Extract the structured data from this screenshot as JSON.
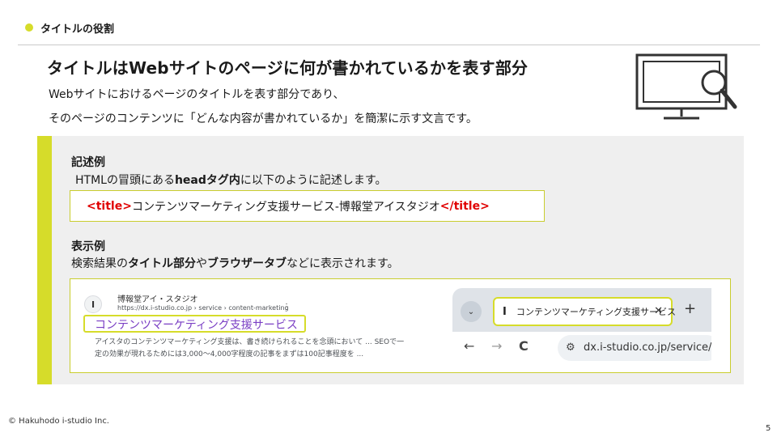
{
  "header": {
    "section_label": "タイトルの役割"
  },
  "main": {
    "headline": "タイトルはWebサイトのページに何が書かれているかを表す部分",
    "lead_line1": "Webサイトにおけるページのタイトルを表す部分であり、",
    "lead_line2": "そのページのコンテンツに「どんな内容が書かれているか」を簡潔に示す文言です。"
  },
  "example": {
    "heading": "記述例",
    "desc_pre": "HTMLの冒頭にある",
    "desc_bold": "headタグ内",
    "desc_post": "に以下のように記述します。",
    "code_open": "<title>",
    "code_text": "コンテンツマーケティング支援サービス-博報堂アイスタジオ",
    "code_close": "</title>"
  },
  "display": {
    "heading": "表示例",
    "desc_pre": "検索結果の",
    "desc_bold1": "タイトル部分",
    "desc_mid": "や",
    "desc_bold2": "ブラウザータブ",
    "desc_post": "などに表示されます。"
  },
  "search_result": {
    "favicon": "I",
    "site_name": "博報堂アイ・スタジオ",
    "url": "https://dx.i-studio.co.jp › service › content-marketing",
    "more": "⋮",
    "title": "コンテンツマーケティング支援サービス",
    "snippet_line1": "アイスタのコンテンツマーケティング支援は、書き続けられることを念頭において ... SEOで一",
    "snippet_line2": "定の効果が現れるためには3,000〜4,000字程度の記事をまずは100記事程度を ..."
  },
  "browser": {
    "tab_favicon": "I",
    "tab_title": "コンテンツマーケティング支援サービス",
    "tab_close": "✕",
    "new_tab": "+",
    "menu": "⌄",
    "back": "←",
    "forward": "→",
    "reload": "C",
    "url": "dx.i-studio.co.jp/service/co"
  },
  "footer": {
    "copyright": "© Hakuhodo i-studio Inc.",
    "page_number": "5"
  },
  "colors": {
    "accent": "#d6dc2a",
    "tag_red": "#e00000",
    "link_purple": "#7a3fc4"
  }
}
